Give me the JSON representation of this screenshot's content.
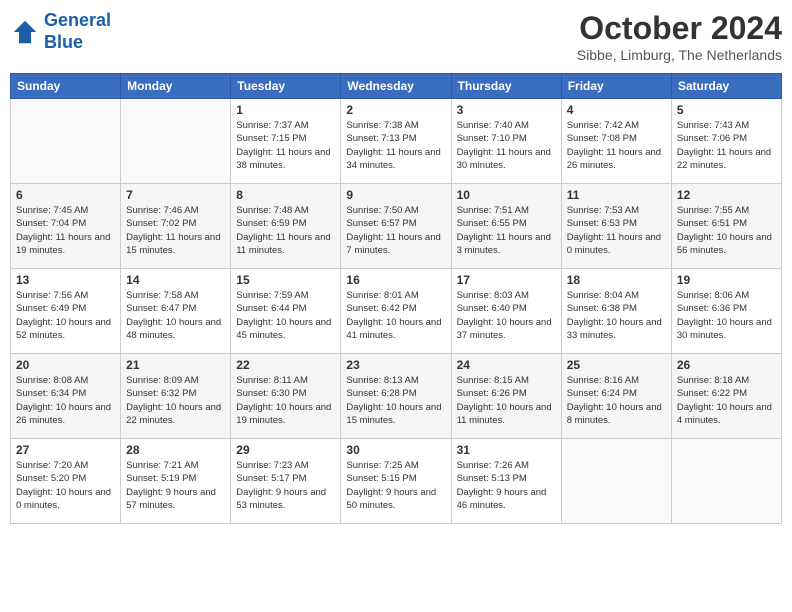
{
  "header": {
    "logo_line1": "General",
    "logo_line2": "Blue",
    "title": "October 2024",
    "location": "Sibbe, Limburg, The Netherlands"
  },
  "days_of_week": [
    "Sunday",
    "Monday",
    "Tuesday",
    "Wednesday",
    "Thursday",
    "Friday",
    "Saturday"
  ],
  "weeks": [
    [
      {
        "day": "",
        "info": ""
      },
      {
        "day": "",
        "info": ""
      },
      {
        "day": "1",
        "info": "Sunrise: 7:37 AM\nSunset: 7:15 PM\nDaylight: 11 hours and 38 minutes."
      },
      {
        "day": "2",
        "info": "Sunrise: 7:38 AM\nSunset: 7:13 PM\nDaylight: 11 hours and 34 minutes."
      },
      {
        "day": "3",
        "info": "Sunrise: 7:40 AM\nSunset: 7:10 PM\nDaylight: 11 hours and 30 minutes."
      },
      {
        "day": "4",
        "info": "Sunrise: 7:42 AM\nSunset: 7:08 PM\nDaylight: 11 hours and 26 minutes."
      },
      {
        "day": "5",
        "info": "Sunrise: 7:43 AM\nSunset: 7:06 PM\nDaylight: 11 hours and 22 minutes."
      }
    ],
    [
      {
        "day": "6",
        "info": "Sunrise: 7:45 AM\nSunset: 7:04 PM\nDaylight: 11 hours and 19 minutes."
      },
      {
        "day": "7",
        "info": "Sunrise: 7:46 AM\nSunset: 7:02 PM\nDaylight: 11 hours and 15 minutes."
      },
      {
        "day": "8",
        "info": "Sunrise: 7:48 AM\nSunset: 6:59 PM\nDaylight: 11 hours and 11 minutes."
      },
      {
        "day": "9",
        "info": "Sunrise: 7:50 AM\nSunset: 6:57 PM\nDaylight: 11 hours and 7 minutes."
      },
      {
        "day": "10",
        "info": "Sunrise: 7:51 AM\nSunset: 6:55 PM\nDaylight: 11 hours and 3 minutes."
      },
      {
        "day": "11",
        "info": "Sunrise: 7:53 AM\nSunset: 6:53 PM\nDaylight: 11 hours and 0 minutes."
      },
      {
        "day": "12",
        "info": "Sunrise: 7:55 AM\nSunset: 6:51 PM\nDaylight: 10 hours and 56 minutes."
      }
    ],
    [
      {
        "day": "13",
        "info": "Sunrise: 7:56 AM\nSunset: 6:49 PM\nDaylight: 10 hours and 52 minutes."
      },
      {
        "day": "14",
        "info": "Sunrise: 7:58 AM\nSunset: 6:47 PM\nDaylight: 10 hours and 48 minutes."
      },
      {
        "day": "15",
        "info": "Sunrise: 7:59 AM\nSunset: 6:44 PM\nDaylight: 10 hours and 45 minutes."
      },
      {
        "day": "16",
        "info": "Sunrise: 8:01 AM\nSunset: 6:42 PM\nDaylight: 10 hours and 41 minutes."
      },
      {
        "day": "17",
        "info": "Sunrise: 8:03 AM\nSunset: 6:40 PM\nDaylight: 10 hours and 37 minutes."
      },
      {
        "day": "18",
        "info": "Sunrise: 8:04 AM\nSunset: 6:38 PM\nDaylight: 10 hours and 33 minutes."
      },
      {
        "day": "19",
        "info": "Sunrise: 8:06 AM\nSunset: 6:36 PM\nDaylight: 10 hours and 30 minutes."
      }
    ],
    [
      {
        "day": "20",
        "info": "Sunrise: 8:08 AM\nSunset: 6:34 PM\nDaylight: 10 hours and 26 minutes."
      },
      {
        "day": "21",
        "info": "Sunrise: 8:09 AM\nSunset: 6:32 PM\nDaylight: 10 hours and 22 minutes."
      },
      {
        "day": "22",
        "info": "Sunrise: 8:11 AM\nSunset: 6:30 PM\nDaylight: 10 hours and 19 minutes."
      },
      {
        "day": "23",
        "info": "Sunrise: 8:13 AM\nSunset: 6:28 PM\nDaylight: 10 hours and 15 minutes."
      },
      {
        "day": "24",
        "info": "Sunrise: 8:15 AM\nSunset: 6:26 PM\nDaylight: 10 hours and 11 minutes."
      },
      {
        "day": "25",
        "info": "Sunrise: 8:16 AM\nSunset: 6:24 PM\nDaylight: 10 hours and 8 minutes."
      },
      {
        "day": "26",
        "info": "Sunrise: 8:18 AM\nSunset: 6:22 PM\nDaylight: 10 hours and 4 minutes."
      }
    ],
    [
      {
        "day": "27",
        "info": "Sunrise: 7:20 AM\nSunset: 5:20 PM\nDaylight: 10 hours and 0 minutes."
      },
      {
        "day": "28",
        "info": "Sunrise: 7:21 AM\nSunset: 5:19 PM\nDaylight: 9 hours and 57 minutes."
      },
      {
        "day": "29",
        "info": "Sunrise: 7:23 AM\nSunset: 5:17 PM\nDaylight: 9 hours and 53 minutes."
      },
      {
        "day": "30",
        "info": "Sunrise: 7:25 AM\nSunset: 5:15 PM\nDaylight: 9 hours and 50 minutes."
      },
      {
        "day": "31",
        "info": "Sunrise: 7:26 AM\nSunset: 5:13 PM\nDaylight: 9 hours and 46 minutes."
      },
      {
        "day": "",
        "info": ""
      },
      {
        "day": "",
        "info": ""
      }
    ]
  ]
}
